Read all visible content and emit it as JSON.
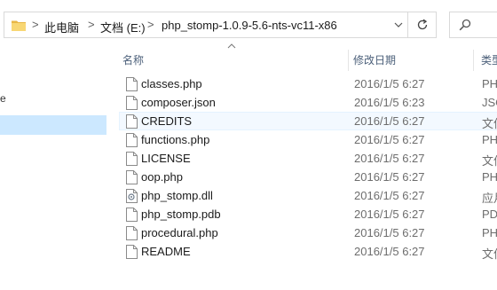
{
  "address": {
    "segments": [
      "此电脑",
      "文档 (E:)",
      "php_stomp-1.0.9-5.6-nts-vc11-x86"
    ],
    "separator": ">"
  },
  "search": {
    "icon": "search-icon"
  },
  "nav": {
    "glyph": "e"
  },
  "columns": {
    "name": "名称",
    "date": "修改日期",
    "type": "类型"
  },
  "files": [
    {
      "name": "classes.php",
      "date": "2016/1/5 6:27",
      "type": "PH",
      "icon": "file-icon"
    },
    {
      "name": "composer.json",
      "date": "2016/1/5 6:23",
      "type": "JSC",
      "icon": "file-icon"
    },
    {
      "name": "CREDITS",
      "date": "2016/1/5 6:27",
      "type": "文件",
      "icon": "file-icon"
    },
    {
      "name": "functions.php",
      "date": "2016/1/5 6:27",
      "type": "PH",
      "icon": "file-icon"
    },
    {
      "name": "LICENSE",
      "date": "2016/1/5 6:27",
      "type": "文件",
      "icon": "file-icon"
    },
    {
      "name": "oop.php",
      "date": "2016/1/5 6:27",
      "type": "PH",
      "icon": "file-icon"
    },
    {
      "name": "php_stomp.dll",
      "date": "2016/1/5 6:27",
      "type": "应月",
      "icon": "dll-file-icon"
    },
    {
      "name": "php_stomp.pdb",
      "date": "2016/1/5 6:27",
      "type": "PD",
      "icon": "file-icon"
    },
    {
      "name": "procedural.php",
      "date": "2016/1/5 6:27",
      "type": "PH",
      "icon": "file-icon"
    },
    {
      "name": "README",
      "date": "2016/1/5 6:27",
      "type": "文件",
      "icon": "file-icon"
    }
  ],
  "colors": {
    "selection": "#cce8ff",
    "hover": "#f3f9ff",
    "header_text": "#4c607a"
  }
}
